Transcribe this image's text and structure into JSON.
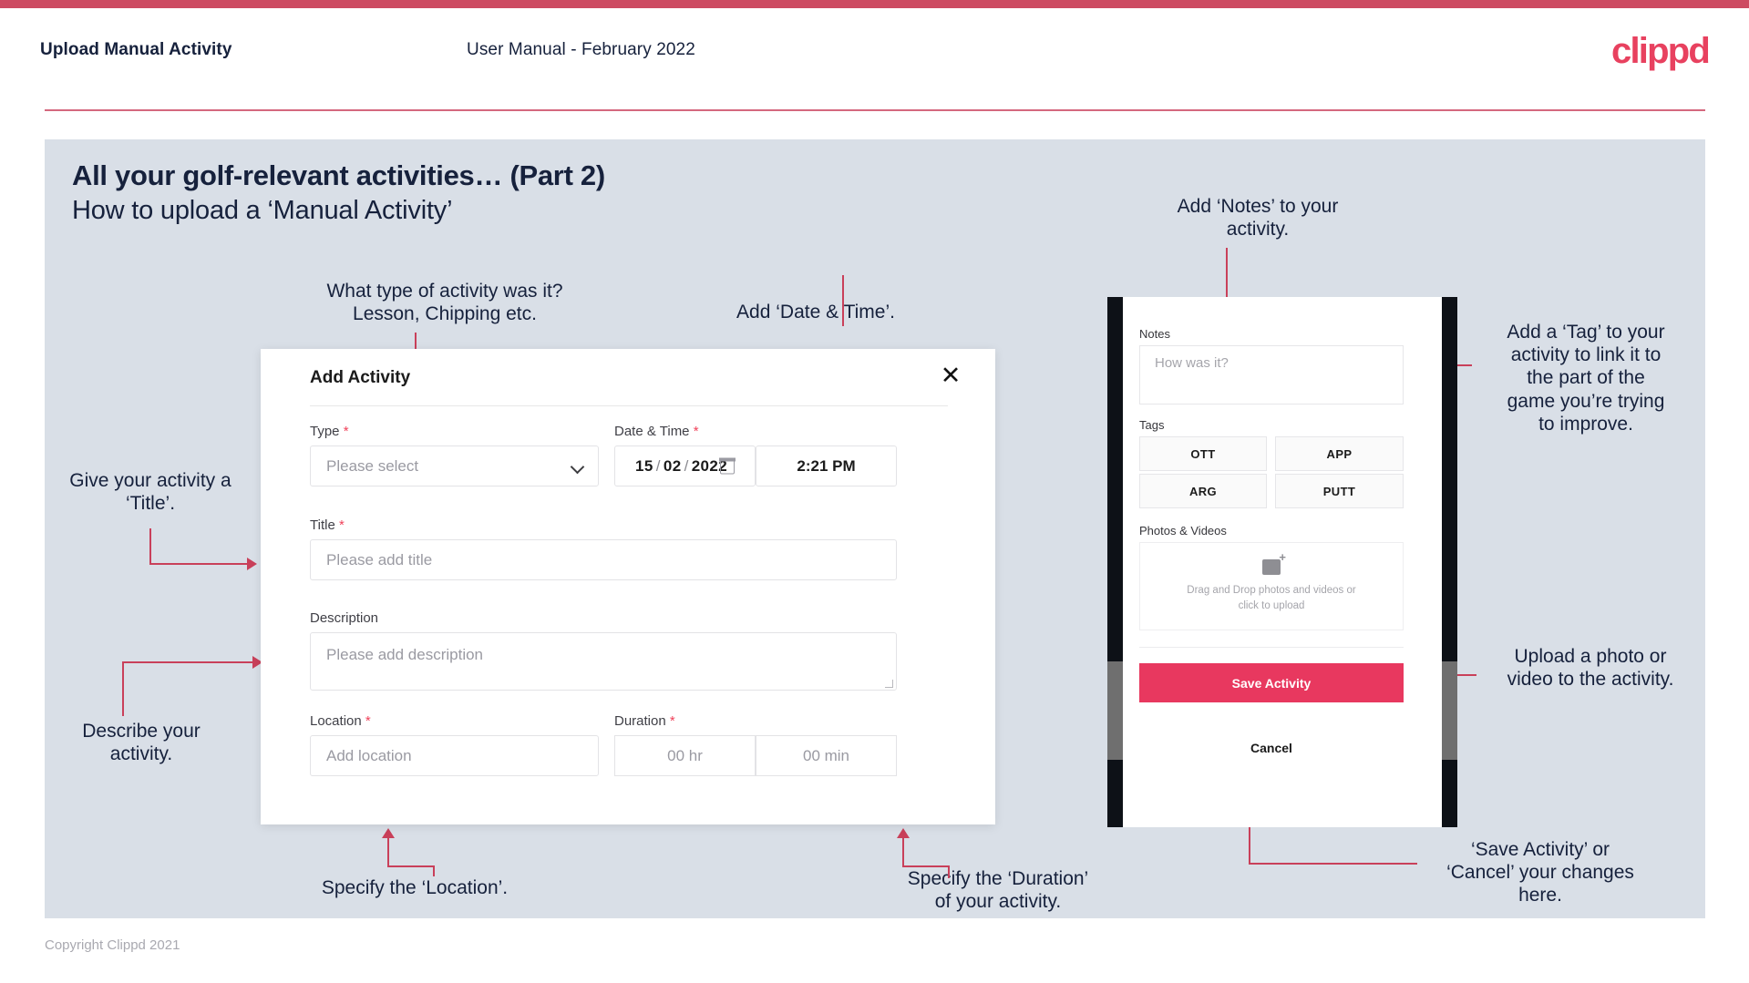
{
  "header": {
    "title": "Upload Manual Activity",
    "subtitle": "User Manual - February 2022",
    "brand": "clippd"
  },
  "slide": {
    "title": "All your golf-relevant activities… (Part 2)",
    "subtitle": "How to upload a ‘Manual Activity’"
  },
  "annotations": {
    "type": "What type of activity was it?\nLesson, Chipping etc.",
    "datetime": "Add ‘Date & Time’.",
    "title_field": "Give your activity a\n‘Title’.",
    "description": "Describe your\nactivity.",
    "location": "Specify the ‘Location’.",
    "duration": "Specify the ‘Duration’\nof your activity.",
    "notes": "Add ‘Notes’ to your\nactivity.",
    "tags": "Add a ‘Tag’ to your\nactivity to link it to\nthe part of the\ngame you’re trying\nto improve.",
    "upload": "Upload a photo or\nvideo to the activity.",
    "save_cancel": "‘Save Activity’ or\n‘Cancel’ your changes\nhere."
  },
  "modal": {
    "title": "Add Activity",
    "close_icon": "✕",
    "fields": {
      "type": {
        "label": "Type",
        "required": "*",
        "placeholder": "Please select"
      },
      "datetime": {
        "label": "Date & Time",
        "required": "*",
        "day": "15",
        "month": "02",
        "year": "2022",
        "separator": "/",
        "time": "2:21 PM"
      },
      "title": {
        "label": "Title",
        "required": "*",
        "placeholder": "Please add title"
      },
      "description": {
        "label": "Description",
        "placeholder": "Please add description"
      },
      "location": {
        "label": "Location",
        "required": "*",
        "placeholder": "Add location"
      },
      "duration": {
        "label": "Duration",
        "required": "*",
        "hours": "00 hr",
        "minutes": "00 min"
      }
    }
  },
  "phone": {
    "notes": {
      "label": "Notes",
      "placeholder": "How was it?"
    },
    "tags": {
      "label": "Tags",
      "items": [
        "OTT",
        "APP",
        "ARG",
        "PUTT"
      ]
    },
    "photos": {
      "label": "Photos & Videos",
      "drop_line1": "Drag and Drop photos and videos or",
      "drop_line2": "click to upload"
    },
    "save_label": "Save Activity",
    "cancel_label": "Cancel"
  },
  "footer": {
    "copyright": "Copyright Clippd 2021"
  },
  "colors": {
    "accent": "#cd4b62",
    "brand": "#e8415f",
    "save_button": "#e8385f",
    "slide_bg": "#d9dfe7",
    "text_dark": "#16213c",
    "connector": "#c9405a"
  }
}
